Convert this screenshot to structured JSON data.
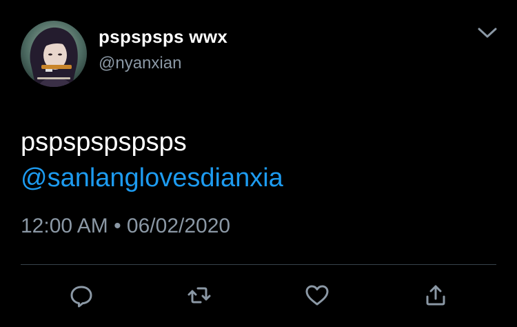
{
  "author": {
    "display_name": "pspspsps wwx",
    "handle": "@nyanxian",
    "avatar_icon": "profile-avatar"
  },
  "tweet": {
    "text": "pspspspspsps",
    "mention": "@sanlanglovesdianxia",
    "time": "12:00 AM",
    "separator": "•",
    "date": "06/02/2020",
    "timestamp_text": "12:00 AM • 06/02/2020"
  },
  "actions": [
    {
      "name": "reply",
      "icon": "reply-icon"
    },
    {
      "name": "retweet",
      "icon": "retweet-icon"
    },
    {
      "name": "like",
      "icon": "heart-icon"
    },
    {
      "name": "share",
      "icon": "share-icon"
    }
  ],
  "colors": {
    "background": "#000000",
    "text": "#ffffff",
    "secondary": "#8b98a5",
    "link": "#1d9bf0",
    "divider": "#38444d"
  }
}
